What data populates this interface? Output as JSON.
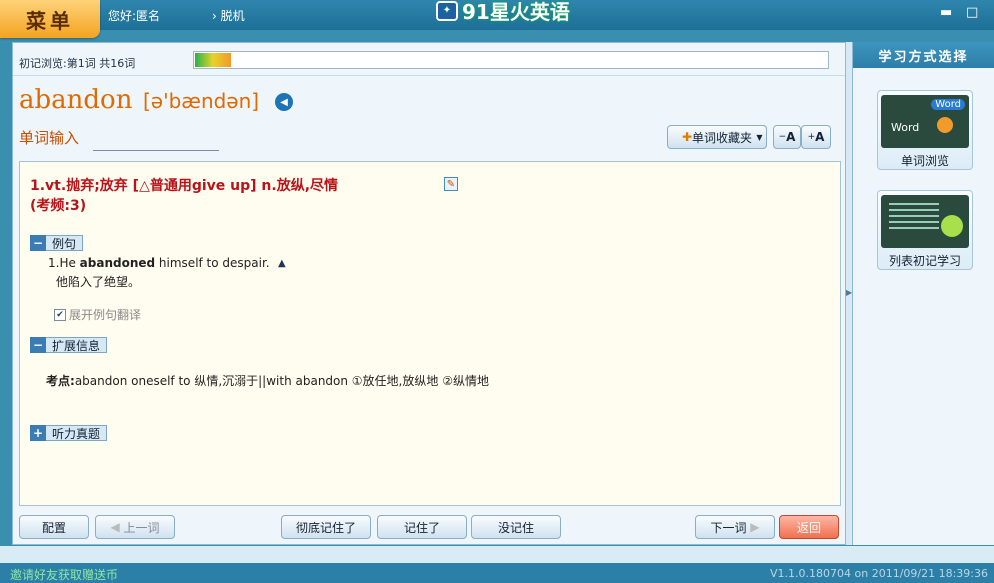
{
  "topbar": {
    "menu_label": "菜单",
    "greeting": "您好:匿名",
    "offline_label": "脱机",
    "app_title": "91星火英语",
    "minimize": "▬",
    "maximize": "□"
  },
  "progress": {
    "label": "初记浏览:第1词  共16词",
    "current": 1,
    "total": 16
  },
  "word": {
    "headword": "abandon",
    "phonetic": "[ə'bændən]"
  },
  "input": {
    "label": "单词输入",
    "value": ""
  },
  "toolbar": {
    "favorites": "单词收藏夹",
    "font_smaller": "A",
    "font_larger": "A"
  },
  "definition": {
    "line1": "1.vt.抛弃;放弃  [△普通用give up]   n.放纵,尽情",
    "line2": "(考频:3)"
  },
  "sections": {
    "examples": {
      "title": "例句",
      "toggle": "−"
    },
    "extended": {
      "title": "扩展信息",
      "toggle": "−"
    },
    "listening": {
      "title": "听力真题",
      "toggle": "+"
    }
  },
  "example": {
    "en_prefix": "1.He ",
    "en_bold": "abandoned",
    "en_suffix": " himself to despair.",
    "zh": "他陷入了绝望。",
    "expand_label": "展开例句翻译"
  },
  "kaodian": {
    "label": "考点:",
    "text": "abandon oneself to 纵情,沉溺于||with abandon ①放任地,放纵地 ②纵情地"
  },
  "bottom_buttons": {
    "config": "配置",
    "prev": "上一词",
    "remember_fully": "彻底记住了",
    "remember": "记住了",
    "not_remember": "没记住",
    "next": "下一词",
    "back": "返回"
  },
  "sidebar": {
    "title": "学习方式选择",
    "mode1": "单词浏览",
    "mode2": "列表初记学习",
    "mode1_tag": "Word",
    "mode1_tag2": "Word"
  },
  "footer": {
    "invite": "邀请好友获取赠送币",
    "version": "V1.1.0.180704 on 2011/09/21 18:39:36"
  }
}
